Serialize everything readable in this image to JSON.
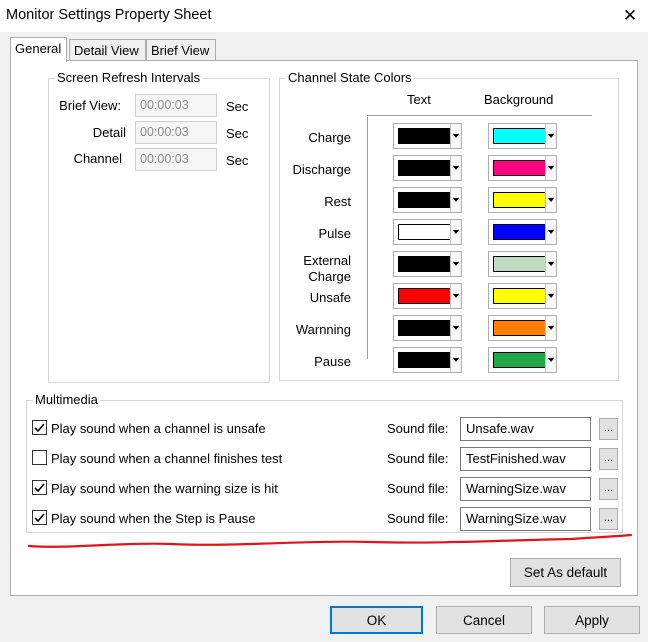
{
  "window": {
    "title": "Monitor Settings Property Sheet",
    "close_glyph": "✕"
  },
  "tabs": [
    "General",
    "Detail View",
    "Brief View"
  ],
  "refresh": {
    "title": "Screen Refresh Intervals",
    "rows": [
      {
        "label": "Brief View:",
        "value": "00:00:03",
        "unit": "Sec"
      },
      {
        "label": "Detail",
        "value": "00:00:03",
        "unit": "Sec"
      },
      {
        "label": "Channel",
        "value": "00:00:03",
        "unit": "Sec"
      }
    ]
  },
  "colors": {
    "title": "Channel State Colors",
    "text_header": "Text",
    "bg_header": "Background",
    "states": [
      {
        "label": "Charge",
        "text_color": "#000000",
        "bg_color": "#00ffff"
      },
      {
        "label": "Discharge",
        "text_color": "#000000",
        "bg_color": "#ff0080"
      },
      {
        "label": "Rest",
        "text_color": "#000000",
        "bg_color": "#ffff00"
      },
      {
        "label": "Pulse",
        "text_color": "#ffffff",
        "bg_color": "#0000ff"
      },
      {
        "label": "External\nCharge",
        "text_color": "#000000",
        "bg_color": "#c0dcc0"
      },
      {
        "label": "Unsafe",
        "text_color": "#ff0000",
        "bg_color": "#ffff00"
      },
      {
        "label": "Warnning",
        "text_color": "#000000",
        "bg_color": "#ff8000"
      },
      {
        "label": "Pause",
        "text_color": "#000000",
        "bg_color": "#1faa4a"
      }
    ]
  },
  "multimedia": {
    "title": "Multimedia",
    "sound_label": "Sound file:",
    "browse_label": "...",
    "items": [
      {
        "label": "Play sound when a channel is unsafe",
        "checked": true,
        "file": "Unsafe.wav"
      },
      {
        "label": "Play sound when a channel finishes test",
        "checked": false,
        "file": "TestFinished.wav"
      },
      {
        "label": "Play sound when the warning size is hit",
        "checked": true,
        "file": "WarningSize.wav"
      },
      {
        "label": "Play sound when the Step is Pause",
        "checked": true,
        "file": "WarningSize.wav"
      }
    ]
  },
  "set_default_label": "Set As default",
  "buttons": {
    "ok": "OK",
    "cancel": "Cancel",
    "apply": "Apply"
  },
  "annotation_color": "#e8101a"
}
